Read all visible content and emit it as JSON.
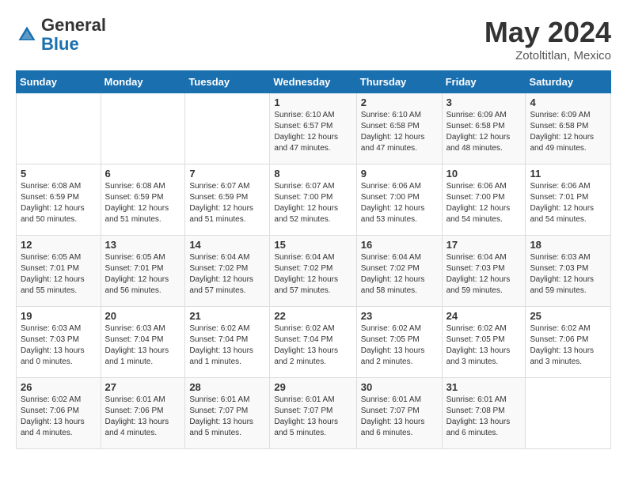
{
  "header": {
    "logo_general": "General",
    "logo_blue": "Blue",
    "month_title": "May 2024",
    "location": "Zotoltitlan, Mexico"
  },
  "days_of_week": [
    "Sunday",
    "Monday",
    "Tuesday",
    "Wednesday",
    "Thursday",
    "Friday",
    "Saturday"
  ],
  "weeks": [
    [
      {
        "day": "",
        "info": ""
      },
      {
        "day": "",
        "info": ""
      },
      {
        "day": "",
        "info": ""
      },
      {
        "day": "1",
        "info": "Sunrise: 6:10 AM\nSunset: 6:57 PM\nDaylight: 12 hours and 47 minutes."
      },
      {
        "day": "2",
        "info": "Sunrise: 6:10 AM\nSunset: 6:58 PM\nDaylight: 12 hours and 47 minutes."
      },
      {
        "day": "3",
        "info": "Sunrise: 6:09 AM\nSunset: 6:58 PM\nDaylight: 12 hours and 48 minutes."
      },
      {
        "day": "4",
        "info": "Sunrise: 6:09 AM\nSunset: 6:58 PM\nDaylight: 12 hours and 49 minutes."
      }
    ],
    [
      {
        "day": "5",
        "info": "Sunrise: 6:08 AM\nSunset: 6:59 PM\nDaylight: 12 hours and 50 minutes."
      },
      {
        "day": "6",
        "info": "Sunrise: 6:08 AM\nSunset: 6:59 PM\nDaylight: 12 hours and 51 minutes."
      },
      {
        "day": "7",
        "info": "Sunrise: 6:07 AM\nSunset: 6:59 PM\nDaylight: 12 hours and 51 minutes."
      },
      {
        "day": "8",
        "info": "Sunrise: 6:07 AM\nSunset: 7:00 PM\nDaylight: 12 hours and 52 minutes."
      },
      {
        "day": "9",
        "info": "Sunrise: 6:06 AM\nSunset: 7:00 PM\nDaylight: 12 hours and 53 minutes."
      },
      {
        "day": "10",
        "info": "Sunrise: 6:06 AM\nSunset: 7:00 PM\nDaylight: 12 hours and 54 minutes."
      },
      {
        "day": "11",
        "info": "Sunrise: 6:06 AM\nSunset: 7:01 PM\nDaylight: 12 hours and 54 minutes."
      }
    ],
    [
      {
        "day": "12",
        "info": "Sunrise: 6:05 AM\nSunset: 7:01 PM\nDaylight: 12 hours and 55 minutes."
      },
      {
        "day": "13",
        "info": "Sunrise: 6:05 AM\nSunset: 7:01 PM\nDaylight: 12 hours and 56 minutes."
      },
      {
        "day": "14",
        "info": "Sunrise: 6:04 AM\nSunset: 7:02 PM\nDaylight: 12 hours and 57 minutes."
      },
      {
        "day": "15",
        "info": "Sunrise: 6:04 AM\nSunset: 7:02 PM\nDaylight: 12 hours and 57 minutes."
      },
      {
        "day": "16",
        "info": "Sunrise: 6:04 AM\nSunset: 7:02 PM\nDaylight: 12 hours and 58 minutes."
      },
      {
        "day": "17",
        "info": "Sunrise: 6:04 AM\nSunset: 7:03 PM\nDaylight: 12 hours and 59 minutes."
      },
      {
        "day": "18",
        "info": "Sunrise: 6:03 AM\nSunset: 7:03 PM\nDaylight: 12 hours and 59 minutes."
      }
    ],
    [
      {
        "day": "19",
        "info": "Sunrise: 6:03 AM\nSunset: 7:03 PM\nDaylight: 13 hours and 0 minutes."
      },
      {
        "day": "20",
        "info": "Sunrise: 6:03 AM\nSunset: 7:04 PM\nDaylight: 13 hours and 1 minute."
      },
      {
        "day": "21",
        "info": "Sunrise: 6:02 AM\nSunset: 7:04 PM\nDaylight: 13 hours and 1 minutes."
      },
      {
        "day": "22",
        "info": "Sunrise: 6:02 AM\nSunset: 7:04 PM\nDaylight: 13 hours and 2 minutes."
      },
      {
        "day": "23",
        "info": "Sunrise: 6:02 AM\nSunset: 7:05 PM\nDaylight: 13 hours and 2 minutes."
      },
      {
        "day": "24",
        "info": "Sunrise: 6:02 AM\nSunset: 7:05 PM\nDaylight: 13 hours and 3 minutes."
      },
      {
        "day": "25",
        "info": "Sunrise: 6:02 AM\nSunset: 7:06 PM\nDaylight: 13 hours and 3 minutes."
      }
    ],
    [
      {
        "day": "26",
        "info": "Sunrise: 6:02 AM\nSunset: 7:06 PM\nDaylight: 13 hours and 4 minutes."
      },
      {
        "day": "27",
        "info": "Sunrise: 6:01 AM\nSunset: 7:06 PM\nDaylight: 13 hours and 4 minutes."
      },
      {
        "day": "28",
        "info": "Sunrise: 6:01 AM\nSunset: 7:07 PM\nDaylight: 13 hours and 5 minutes."
      },
      {
        "day": "29",
        "info": "Sunrise: 6:01 AM\nSunset: 7:07 PM\nDaylight: 13 hours and 5 minutes."
      },
      {
        "day": "30",
        "info": "Sunrise: 6:01 AM\nSunset: 7:07 PM\nDaylight: 13 hours and 6 minutes."
      },
      {
        "day": "31",
        "info": "Sunrise: 6:01 AM\nSunset: 7:08 PM\nDaylight: 13 hours and 6 minutes."
      },
      {
        "day": "",
        "info": ""
      }
    ]
  ]
}
